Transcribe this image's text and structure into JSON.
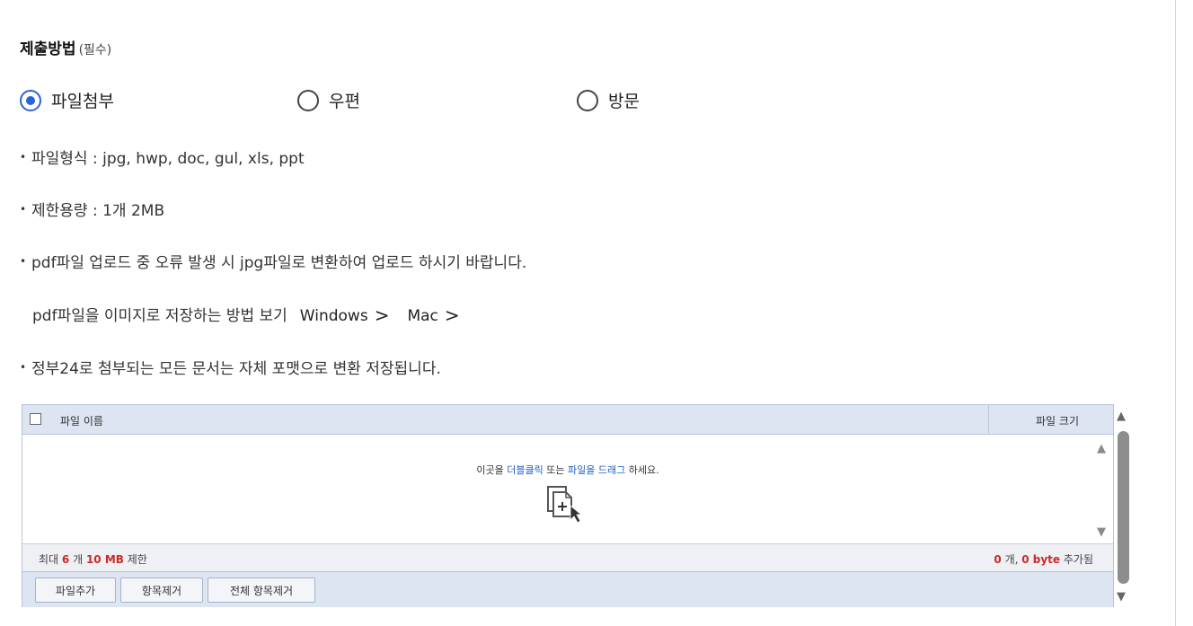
{
  "section": {
    "title": "제출방법",
    "required": "(필수)"
  },
  "submit_methods": [
    {
      "label": "파일첨부",
      "selected": true
    },
    {
      "label": "우편",
      "selected": false
    },
    {
      "label": "방문",
      "selected": false
    }
  ],
  "info": {
    "formats": "파일형식 : jpg, hwp, doc, gul, xls, ppt",
    "limit": "제한용량 : 1개 2MB",
    "pdf_notice": "pdf파일 업로드 중 오류 발생 시 jpg파일로 변환하여 업로드 하시기 바랍니다.",
    "pdf_help": "pdf파일을 이미지로 저장하는 방법 보기",
    "link_windows": "Windows",
    "link_mac": "Mac",
    "chevron": ">",
    "convert_notice": "정부24로 첨부되는 모든 문서는 자체 포맷으로 변환 저장됩니다."
  },
  "uploader": {
    "col_name": "파일 이름",
    "col_size": "파일 크기",
    "drop_hint": {
      "part1": "이곳을 ",
      "part2": "더블클릭",
      "part3": " 또는 ",
      "part4": "파일을 드래그",
      "part5": " 하세요."
    },
    "status_left": {
      "prefix": "최대 ",
      "count": "6",
      "unit1": " 개 ",
      "size": "10 MB",
      "suffix": " 제한"
    },
    "status_right": {
      "count": "0",
      "unit1": " 개, ",
      "size": "0 byte",
      "suffix": " 추가됨"
    },
    "buttons": {
      "add": "파일추가",
      "remove": "항목제거",
      "remove_all": "전체 항목제거"
    }
  },
  "colors": {
    "accent": "#2a63d6",
    "highlight_red": "#cc2a2a",
    "link_blue": "#1f5fbf",
    "header_bg": "#dde4f2"
  }
}
